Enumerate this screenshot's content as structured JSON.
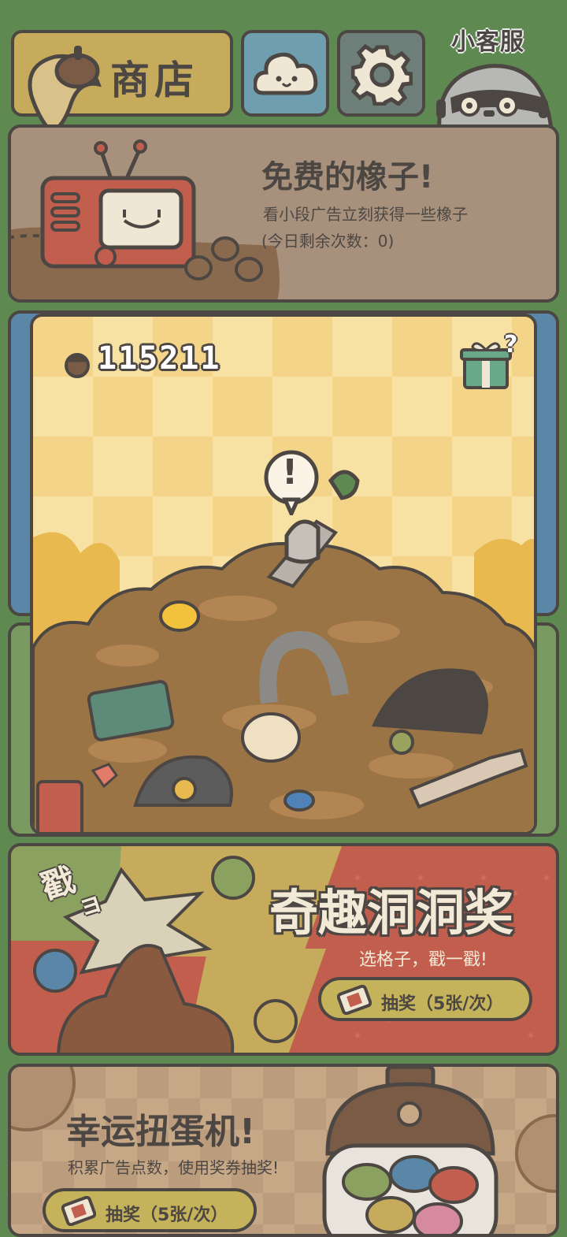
{
  "top_bar": {
    "shop_label": "商店",
    "customer_service_label": "小客服"
  },
  "free_acorns": {
    "title": "免费的橡子!",
    "description": "看小段广告立刻获得一些橡子",
    "remaining": "(今日剩余次数：0)"
  },
  "dig": {
    "acorn_count": "115211",
    "alert_symbol": "!",
    "gift_question": "?"
  },
  "lottery": {
    "poke_text": "戳",
    "poke_suffix": "ョ",
    "title": "奇趣洞洞奖",
    "subtitle": "选格子，戳一戳!",
    "button_label": "抽奖（5张/次）"
  },
  "gacha": {
    "title": "幸运扭蛋机!",
    "subtitle": "积累广告点数，使用奖券抽奖!",
    "button_label": "抽奖（5张/次）"
  },
  "colors": {
    "background": "#5e8a52",
    "outline": "#4d4744",
    "shop_button": "#c6ab5c",
    "cloud_button": "#6f9eaf",
    "settings_button": "#6e7f7a",
    "free_panel": "#a8917c",
    "dig_panel": "#f5d98e",
    "lottery_red": "#c25e4e",
    "lottery_pill": "#c4b35a"
  }
}
